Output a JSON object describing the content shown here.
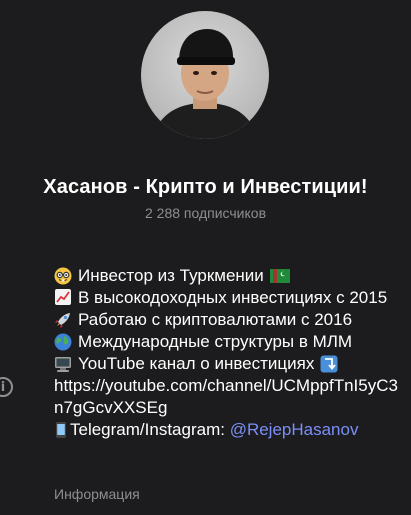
{
  "channel": {
    "title": "Хасанов - Крипто и Инвестиции!",
    "subscribers": "2 288 подписчиков"
  },
  "description": {
    "line1": "Инвестор из Туркмении",
    "line2": "В высокодоходных инвестициях с 2015",
    "line3": "Работаю с криптовалютами с 2016",
    "line4": "Международные структуры в МЛМ",
    "line5": "YouTube канал о инвестициях",
    "link": "https://youtube.com/channel/UCMppfTnI5yC3n7gGcvXXSEg",
    "line7_prefix": "Telegram/Instagram: ",
    "mention": "@RejepHasanov"
  },
  "info_label": "Информация",
  "icons": [
    "avatar",
    "nerd-face-icon",
    "turkmenistan-flag-icon",
    "chart-increasing-icon",
    "rocket-icon",
    "globe-icon",
    "computer-icon",
    "arrow-down-icon",
    "mobile-phone-icon",
    "info-icon"
  ]
}
